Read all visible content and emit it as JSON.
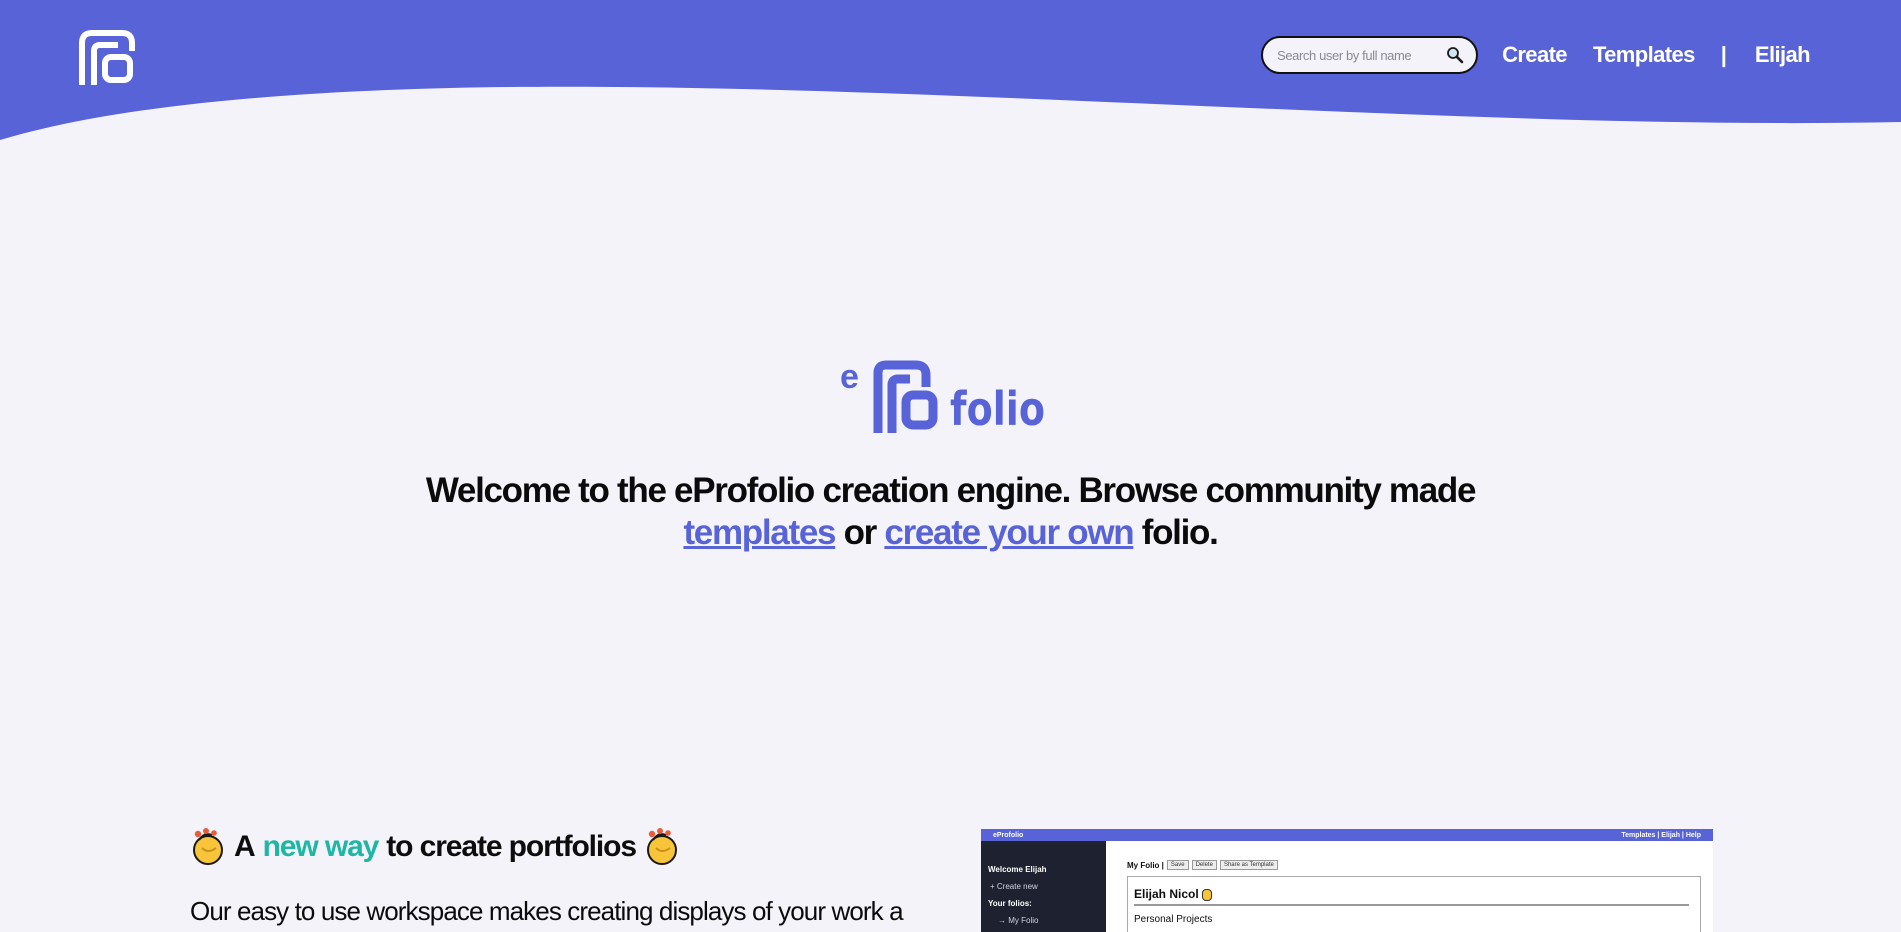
{
  "header": {
    "search_placeholder": "Search user by full name",
    "nav_create": "Create",
    "nav_templates": "Templates",
    "separator": "|",
    "user_name": "Elijah"
  },
  "hero": {
    "line1": "Welcome to the eProfolio creation engine. Browse community made",
    "link_templates": "templates",
    "word_or": " or ",
    "link_create": "create your own",
    "word_folio": " folio."
  },
  "feature": {
    "title_prefix": "A ",
    "title_accent": "new way",
    "title_suffix": " to create portfolios",
    "body": "Our easy to use workspace makes creating displays of your work a"
  },
  "preview": {
    "brand": "eProfolio",
    "top_links": "Templates | Elijah | Help",
    "welcome": "Welcome Elijah",
    "create_new": "+ Create new",
    "your_folios": "Your folios:",
    "my_folio_link": "→ My Folio",
    "folio_title": "My Folio |",
    "btn_save": "Save",
    "btn_delete": "Delete",
    "btn_share": "Share as Template",
    "card_name": "Elijah Nicol",
    "card_section": "Personal Projects"
  },
  "colors": {
    "brand": "#5763d6",
    "accent": "#1eb6a5",
    "background": "#f4f3f9"
  }
}
